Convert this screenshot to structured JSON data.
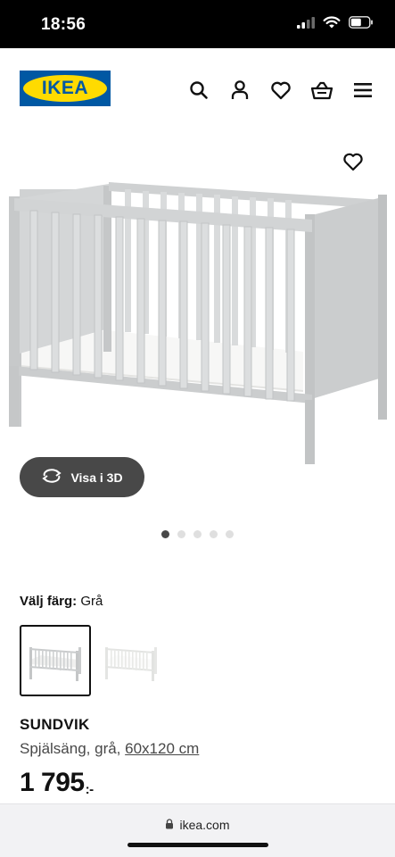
{
  "status_bar": {
    "time": "18:56",
    "icons": [
      "cellular-signal-icon",
      "wifi-icon",
      "battery-icon"
    ]
  },
  "header": {
    "logo_text": "IKEA",
    "nav_icons": [
      "search-icon",
      "user-icon",
      "heart-icon",
      "shopping-basket-icon",
      "menu-icon"
    ]
  },
  "gallery": {
    "view_3d_label": "Visa i 3D",
    "dots_total": 5,
    "dots_active_index": 0
  },
  "product": {
    "color_label": "Välj färg:",
    "color_value": "Grå",
    "swatches": [
      {
        "name": "Grå",
        "selected": true
      },
      {
        "name": "Vit",
        "selected": false
      }
    ],
    "name": "SUNDVIK",
    "desc_prefix": "Spjälsäng, grå, ",
    "desc_size": "60x120 cm",
    "price": "1 795",
    "price_suffix": ":-"
  },
  "browser": {
    "url": "ikea.com"
  },
  "colors": {
    "ikea_blue": "#0058a3",
    "ikea_yellow": "#ffdb00",
    "crib_gray": "#c9cbcc",
    "crib_white": "#f4f4f2"
  }
}
